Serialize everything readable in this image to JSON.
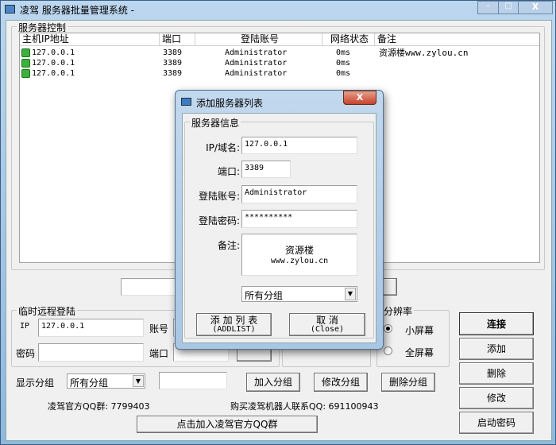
{
  "window": {
    "title": "凌驾 服务器批量管理系统  -",
    "minimize": "–",
    "maximize": "□",
    "close": "X"
  },
  "server_group": {
    "legend": "服务器控制",
    "columns": [
      "主机IP地址",
      "端口",
      "登陆账号",
      "网络状态",
      "备注"
    ],
    "rows": [
      {
        "ip": "127.0.0.1",
        "port": "3389",
        "account": "Administrator",
        "status": "0ms",
        "note": "资源楼www.zylou.cn"
      },
      {
        "ip": "127.0.0.1",
        "port": "3389",
        "account": "Administrator",
        "status": "0ms",
        "note": ""
      },
      {
        "ip": "127.0.0.1",
        "port": "3389",
        "account": "Administrator",
        "status": "0ms",
        "note": ""
      }
    ]
  },
  "temp_login": {
    "legend": "临时远程登陆",
    "ip_label": "IP",
    "ip_value": "127.0.0.1",
    "account_label": "账号",
    "password_label": "密码",
    "port_label": "端口"
  },
  "resolution": {
    "legend": "分辨率",
    "small": "小屏幕",
    "full": "全屏幕",
    "selected": "small"
  },
  "side_buttons": {
    "connect": "连接",
    "add": "添加",
    "delete": "删除",
    "modify": "修改",
    "boot_password": "启动密码"
  },
  "group_bar": {
    "label": "显示分组",
    "select": "所有分组",
    "join": "加入分组",
    "edit": "修改分组",
    "remove": "删除分组"
  },
  "footer": {
    "qq_group": "凌驾官方QQ群: 7799403",
    "buy": "购买凌驾机器人联系QQ: 691100943",
    "join_button": "点击加入凌驾官方QQ群"
  },
  "dialog": {
    "title": "添加服务器列表",
    "close": "X",
    "legend": "服务器信息",
    "ip_label": "IP/域名:",
    "ip_value": "127.0.0.1",
    "port_label": "端口:",
    "port_value": "3389",
    "account_label": "登陆账号:",
    "account_value": "Administrator",
    "password_label": "登陆密码:",
    "password_value": "**********",
    "note_label": "备注:",
    "note_line1": "资源楼",
    "note_line2": "www.zylou.cn",
    "group_select": "所有分组",
    "add_button": "添 加 列 表",
    "add_button_sub": "(ADDLIST)",
    "cancel_button": "取 消",
    "cancel_button_sub": "(Close)"
  }
}
